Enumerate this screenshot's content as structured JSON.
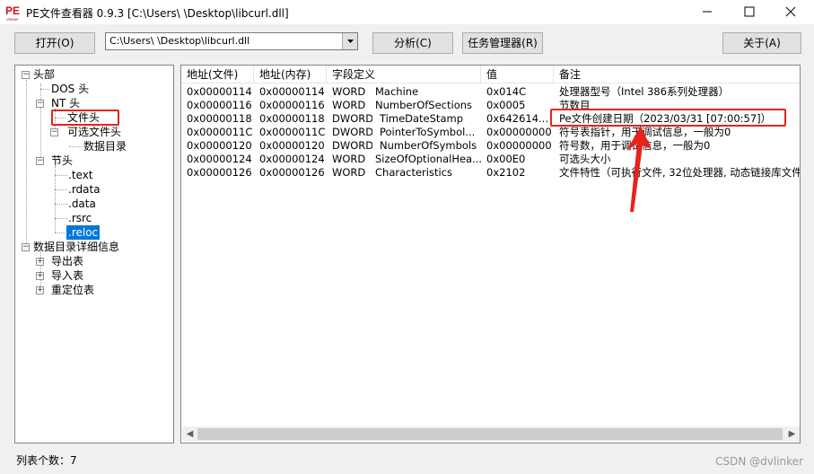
{
  "window": {
    "title": "PE文件查看器 0.9.3 [C:\\Users\\          \\Desktop\\libcurl.dll]",
    "icon_text_top": "PE",
    "icon_text_bottom": "Viewer"
  },
  "toolbar": {
    "open_label": "打开(O)",
    "path_value": "C:\\Users\\          \\Desktop\\libcurl.dll",
    "analyze_label": "分析(C)",
    "taskmgr_label": "任务管理器(R)",
    "about_label": "关于(A)"
  },
  "tree": {
    "root_header": "头部",
    "dos": "DOS 头",
    "nt": "NT 头",
    "file_header": "文件头",
    "optional_header": "可选文件头",
    "data_dir": "数据目录",
    "section_header": "节头",
    "sections": [
      ".text",
      ".rdata",
      ".data",
      ".rsrc",
      ".reloc"
    ],
    "data_dir_detail": "数据目录详细信息",
    "export": "导出表",
    "import": "导入表",
    "reloc_table": "重定位表"
  },
  "table": {
    "columns": [
      "地址(文件)",
      "地址(内存)",
      "字段定义",
      "值",
      "备注"
    ],
    "rows": [
      {
        "file": "0x00000114",
        "mem": "0x00000114",
        "type": "WORD",
        "name": "Machine",
        "value": "0x014C",
        "note": "处理器型号（Intel 386系列处理器）"
      },
      {
        "file": "0x00000116",
        "mem": "0x00000116",
        "type": "WORD",
        "name": "NumberOfSections",
        "value": "0x0005",
        "note": "节数目"
      },
      {
        "file": "0x00000118",
        "mem": "0x00000118",
        "type": "DWORD",
        "name": "TimeDateStamp",
        "value": "0x642614...",
        "note": "Pe文件创建日期（2023/03/31 [07:00:57]）"
      },
      {
        "file": "0x0000011C",
        "mem": "0x0000011C",
        "type": "DWORD",
        "name": "PointerToSymbol...",
        "value": "0x00000000",
        "note": "符号表指针，用于调试信息，一般为0"
      },
      {
        "file": "0x00000120",
        "mem": "0x00000120",
        "type": "DWORD",
        "name": "NumberOfSymbols",
        "value": "0x00000000",
        "note": "符号数，用于调试信息，一般为0"
      },
      {
        "file": "0x00000124",
        "mem": "0x00000124",
        "type": "WORD",
        "name": "SizeOfOptionalHea...",
        "value": "0x00E0",
        "note": "可选头大小"
      },
      {
        "file": "0x00000126",
        "mem": "0x00000126",
        "type": "WORD",
        "name": "Characteristics",
        "value": "0x2102",
        "note": "文件特性（可执行文件, 32位处理器, 动态链接库文件"
      }
    ]
  },
  "status": {
    "count_text": "列表个数：7"
  },
  "watermark": "CSDN @dvlinker",
  "icons": {
    "minimize": "minimize-icon",
    "maximize": "maximize-icon",
    "close": "close-icon"
  },
  "colors": {
    "selection": "#0078d7",
    "annotation": "#e8231a"
  }
}
